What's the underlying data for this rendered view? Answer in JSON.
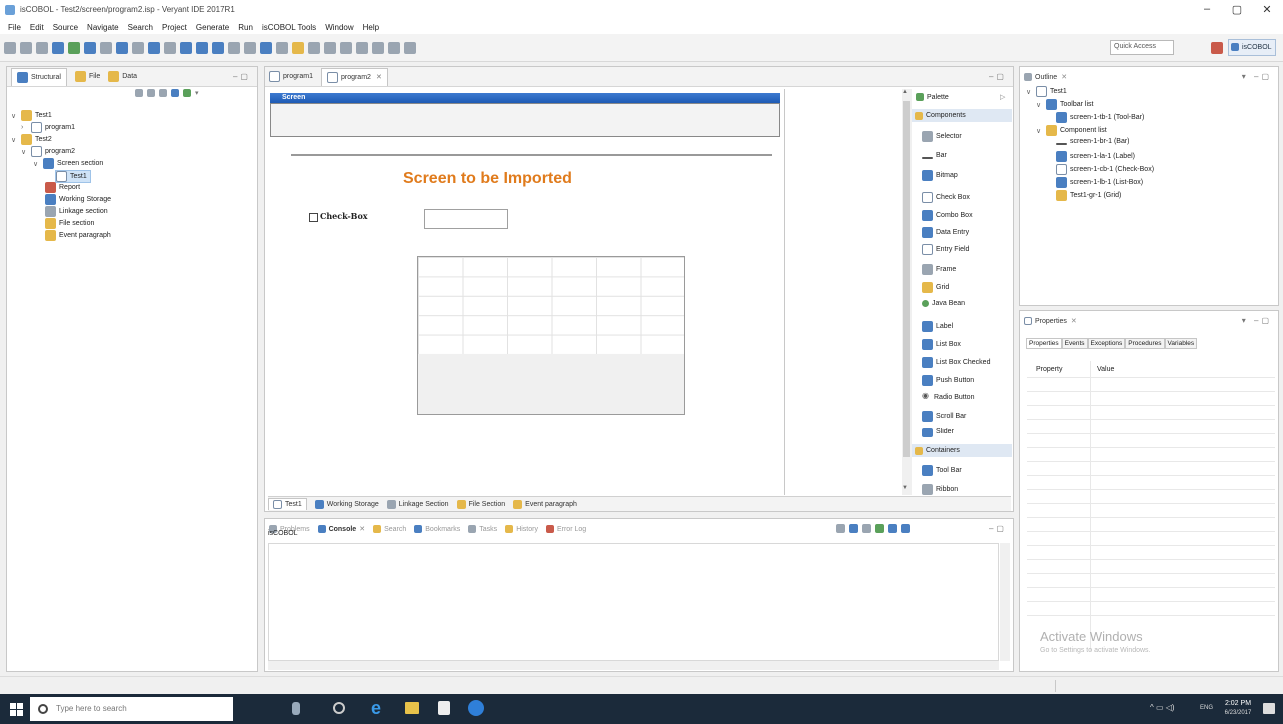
{
  "window": {
    "title": "isCOBOL - Test2/screen/program2.isp - Veryant IDE 2017R1",
    "minimize": "–",
    "maximize": "▢",
    "close": "✕"
  },
  "menu": [
    "File",
    "Edit",
    "Source",
    "Navigate",
    "Search",
    "Project",
    "Generate",
    "Run",
    "isCOBOL Tools",
    "Window",
    "Help"
  ],
  "toolbar": {
    "quick_access": "Quick Access",
    "perspective": "isCOBOL"
  },
  "left_panel": {
    "tabs": [
      "Structural",
      "File",
      "Data"
    ],
    "tree": [
      {
        "label": "Test1",
        "depth": 0,
        "twisty": "∨"
      },
      {
        "label": "program1",
        "depth": 1,
        "twisty": "›"
      },
      {
        "label": "Test2",
        "depth": 0,
        "twisty": "∨"
      },
      {
        "label": "program2",
        "depth": 1,
        "twisty": "∨"
      },
      {
        "label": "Screen section",
        "depth": 2,
        "twisty": "∨"
      },
      {
        "label": "Test1",
        "depth": 3,
        "twisty": ""
      },
      {
        "label": "Report",
        "depth": 2,
        "twisty": ""
      },
      {
        "label": "Working Storage",
        "depth": 2,
        "twisty": ""
      },
      {
        "label": "Linkage section",
        "depth": 2,
        "twisty": ""
      },
      {
        "label": "File section",
        "depth": 2,
        "twisty": ""
      },
      {
        "label": "Event paragraph",
        "depth": 2,
        "twisty": ""
      }
    ]
  },
  "editor": {
    "tabs": [
      "program1",
      "program2"
    ],
    "screen_title": "Screen",
    "screen_label": "Screen to be Imported",
    "checkbox_label": "Check-Box",
    "bottom_tabs": [
      "Test1",
      "Working Storage",
      "Linkage Section",
      "File Section",
      "Event paragraph"
    ]
  },
  "palette": {
    "title": "Palette",
    "components_header": "Components",
    "items": [
      "Selector",
      "Bar",
      "Bitmap",
      "Check Box",
      "Combo Box",
      "Data Entry",
      "Entry Field",
      "Frame",
      "Grid",
      "Java Bean",
      "Label",
      "List Box",
      "List Box Checked",
      "Push Button",
      "Radio Button",
      "Scroll Bar",
      "Slider"
    ],
    "containers_header": "Containers",
    "containers": [
      "Tool Bar",
      "Ribbon"
    ]
  },
  "outline": {
    "title": "Outline",
    "tree": [
      {
        "label": "Test1",
        "depth": 0,
        "twisty": "∨"
      },
      {
        "label": "Toolbar list",
        "depth": 1,
        "twisty": "∨"
      },
      {
        "label": "screen-1-tb-1 (Tool-Bar)",
        "depth": 2,
        "twisty": ""
      },
      {
        "label": "Component list",
        "depth": 1,
        "twisty": "∨"
      },
      {
        "label": "screen-1-br-1 (Bar)",
        "depth": 2,
        "twisty": ""
      },
      {
        "label": "screen-1-la-1 (Label)",
        "depth": 2,
        "twisty": ""
      },
      {
        "label": "screen-1-cb-1 (Check-Box)",
        "depth": 2,
        "twisty": ""
      },
      {
        "label": "screen-1-lb-1 (List-Box)",
        "depth": 2,
        "twisty": ""
      },
      {
        "label": "Test1-gr-1 (Grid)",
        "depth": 2,
        "twisty": ""
      }
    ]
  },
  "properties": {
    "title": "Properties",
    "tabs": [
      "Properties",
      "Events",
      "Exceptions",
      "Procedures",
      "Variables"
    ],
    "col_property": "Property",
    "col_value": "Value"
  },
  "console": {
    "tabs": [
      "Problems",
      "Console",
      "Search",
      "Bookmarks",
      "Tasks",
      "History",
      "Error Log"
    ],
    "content": "isCOBOL"
  },
  "watermark": {
    "line1": "Activate Windows",
    "line2": "Go to Settings to activate Windows."
  },
  "taskbar": {
    "search_placeholder": "Type here to search",
    "lang": "ENG",
    "time": "2:02 PM",
    "date": "6/23/2017"
  }
}
